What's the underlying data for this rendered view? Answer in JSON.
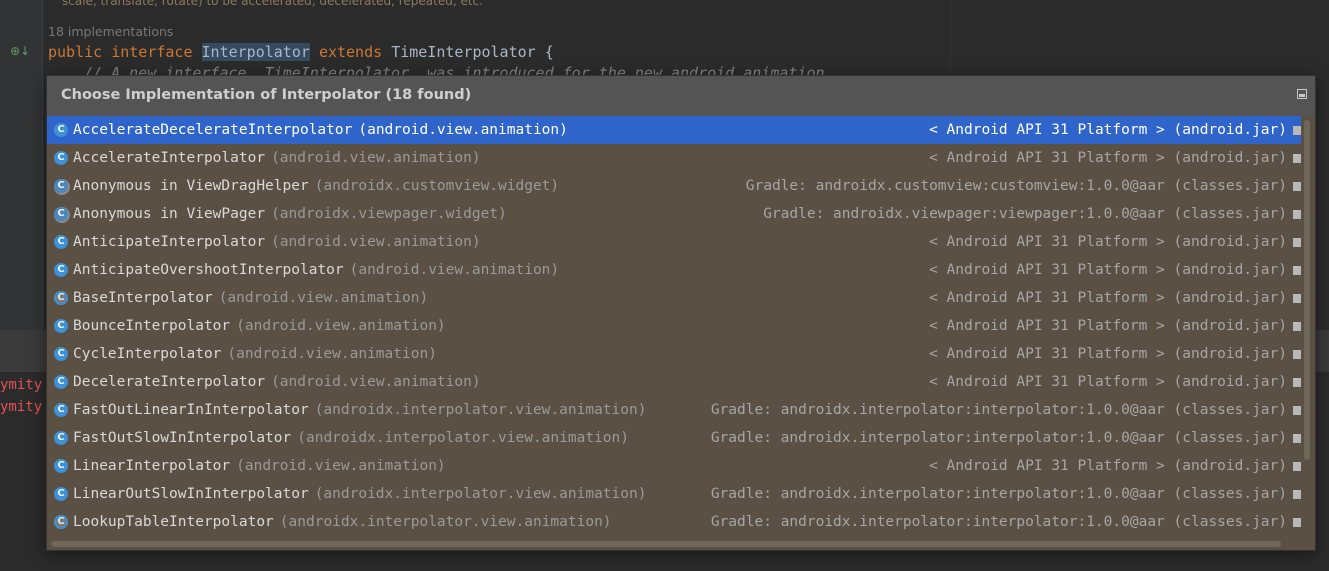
{
  "editor": {
    "doc_comment": "scale, translate, rotate) to be accelerated, decelerated, repeated, etc.",
    "implementations_hint": "18 implementations",
    "code": {
      "kw_public": "public",
      "kw_interface": "interface",
      "type_name": "Interpolator",
      "kw_extends": "extends",
      "super_type": "TimeInterpolator {",
      "comment": "// A new interface, TimeInterpolator, was introduced for the new android.animation"
    },
    "gutter_icon": "⊕↓",
    "bottom_text_1": "ymity",
    "bottom_text_2": "ymity"
  },
  "popup": {
    "title": "Choose Implementation of Interpolator (18 found)",
    "pin_icon": "pin-icon",
    "items": [
      {
        "name": "AccelerateDecelerateInterpolator",
        "package": "(android.view.animation)",
        "library": "< Android API 31 Platform > (android.jar)",
        "icon": "C",
        "icon_type": "class",
        "selected": true
      },
      {
        "name": "AccelerateInterpolator",
        "package": "(android.view.animation)",
        "library": "< Android API 31 Platform > (android.jar)",
        "icon": "C",
        "icon_type": "class"
      },
      {
        "name": "Anonymous in ViewDragHelper",
        "package": "(androidx.customview.widget)",
        "library": "Gradle: androidx.customview:customview:1.0.0@aar (classes.jar)",
        "icon": "C",
        "icon_type": "anonymous"
      },
      {
        "name": "Anonymous in ViewPager",
        "package": "(androidx.viewpager.widget)",
        "library": "Gradle: androidx.viewpager:viewpager:1.0.0@aar (classes.jar)",
        "icon": "C",
        "icon_type": "anonymous"
      },
      {
        "name": "AnticipateInterpolator",
        "package": "(android.view.animation)",
        "library": "< Android API 31 Platform > (android.jar)",
        "icon": "C",
        "icon_type": "class"
      },
      {
        "name": "AnticipateOvershootInterpolator",
        "package": "(android.view.animation)",
        "library": "< Android API 31 Platform > (android.jar)",
        "icon": "C",
        "icon_type": "class"
      },
      {
        "name": "BaseInterpolator",
        "package": "(android.view.animation)",
        "library": "< Android API 31 Platform > (android.jar)",
        "icon": "C",
        "icon_type": "abstract"
      },
      {
        "name": "BounceInterpolator",
        "package": "(android.view.animation)",
        "library": "< Android API 31 Platform > (android.jar)",
        "icon": "C",
        "icon_type": "class"
      },
      {
        "name": "CycleInterpolator",
        "package": "(android.view.animation)",
        "library": "< Android API 31 Platform > (android.jar)",
        "icon": "C",
        "icon_type": "class"
      },
      {
        "name": "DecelerateInterpolator",
        "package": "(android.view.animation)",
        "library": "< Android API 31 Platform > (android.jar)",
        "icon": "C",
        "icon_type": "class"
      },
      {
        "name": "FastOutLinearInInterpolator",
        "package": "(androidx.interpolator.view.animation)",
        "library": "Gradle: androidx.interpolator:interpolator:1.0.0@aar (classes.jar)",
        "icon": "C",
        "icon_type": "class"
      },
      {
        "name": "FastOutSlowInInterpolator",
        "package": "(androidx.interpolator.view.animation)",
        "library": "Gradle: androidx.interpolator:interpolator:1.0.0@aar (classes.jar)",
        "icon": "C",
        "icon_type": "class"
      },
      {
        "name": "LinearInterpolator",
        "package": "(android.view.animation)",
        "library": "< Android API 31 Platform > (android.jar)",
        "icon": "C",
        "icon_type": "class"
      },
      {
        "name": "LinearOutSlowInInterpolator",
        "package": "(androidx.interpolator.view.animation)",
        "library": "Gradle: androidx.interpolator:interpolator:1.0.0@aar (classes.jar)",
        "icon": "C",
        "icon_type": "class"
      },
      {
        "name": "LookupTableInterpolator",
        "package": "(androidx.interpolator.view.animation)",
        "library": "Gradle: androidx.interpolator:interpolator:1.0.0@aar (classes.jar)",
        "icon": "C",
        "icon_type": "abstract"
      }
    ]
  },
  "colors": {
    "selection": "#2f65ca",
    "popup_bg": "#5a5043",
    "header_bg": "#545454",
    "keyword": "#cc7832",
    "error_text": "#e05252"
  }
}
